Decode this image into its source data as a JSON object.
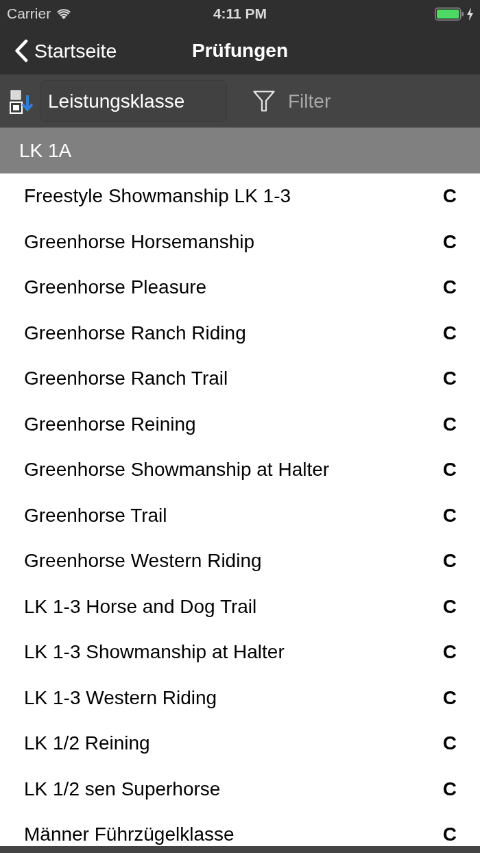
{
  "status_bar": {
    "carrier": "Carrier",
    "time": "4:11 PM",
    "charging": true
  },
  "nav_bar": {
    "back_label": "Startseite",
    "title": "Prüfungen"
  },
  "toolbar": {
    "sort_field": "Leistungsklasse",
    "filter_label": "Filter"
  },
  "sections": [
    {
      "title": "LK 1A",
      "rows": [
        {
          "name": "Freestyle Showmanship LK 1-3",
          "grade": "C"
        },
        {
          "name": "Greenhorse Horsemanship",
          "grade": "C"
        },
        {
          "name": "Greenhorse Pleasure",
          "grade": "C"
        },
        {
          "name": "Greenhorse Ranch Riding",
          "grade": "C"
        },
        {
          "name": "Greenhorse Ranch Trail",
          "grade": "C"
        },
        {
          "name": "Greenhorse Reining",
          "grade": "C"
        },
        {
          "name": "Greenhorse Showmanship at Halter",
          "grade": "C"
        },
        {
          "name": "Greenhorse Trail",
          "grade": "C"
        },
        {
          "name": "Greenhorse Western Riding",
          "grade": "C"
        },
        {
          "name": "LK 1-3 Horse and Dog Trail",
          "grade": "C"
        },
        {
          "name": "LK 1-3 Showmanship at Halter",
          "grade": "C"
        },
        {
          "name": "LK 1-3 Western Riding",
          "grade": "C"
        },
        {
          "name": "LK 1/2 Reining",
          "grade": "C"
        },
        {
          "name": "LK 1/2 sen Superhorse",
          "grade": "C"
        },
        {
          "name": "Männer Führzügelklasse",
          "grade": "C"
        }
      ]
    }
  ]
}
